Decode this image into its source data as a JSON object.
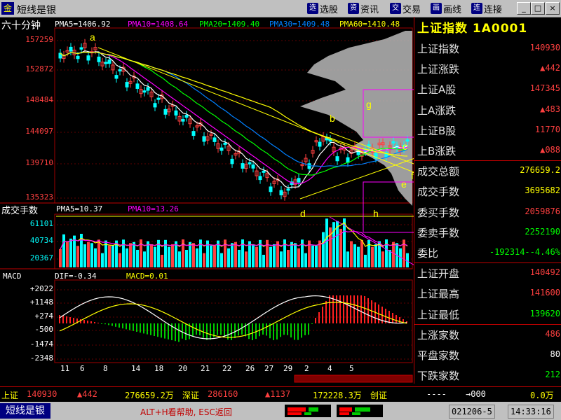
{
  "window": {
    "app_name": "短线是银",
    "app_icon": "金"
  },
  "toolbar": [
    {
      "label": "选股",
      "icon": "选"
    },
    {
      "label": "资讯",
      "icon": "资"
    },
    {
      "label": "交易",
      "icon": "交"
    },
    {
      "label": "画线",
      "icon": "画"
    },
    {
      "label": "连接",
      "icon": "连"
    }
  ],
  "window_buttons": [
    "_",
    "□",
    "×"
  ],
  "price_chart": {
    "period": "六十分钟",
    "ma": [
      {
        "label": "PMA5=1406.92",
        "color": "#ffffff"
      },
      {
        "label": "PMA10=1408.64",
        "color": "#ff00ff"
      },
      {
        "label": "PMA20=1409.40",
        "color": "#00ff00"
      },
      {
        "label": "PMA30=1409.48",
        "color": "#0080ff"
      },
      {
        "label": "PMA60=1410.48",
        "color": "#ffff00"
      }
    ],
    "y_ticks": [
      "157259",
      "152872",
      "148484",
      "144097",
      "139710",
      "135323"
    ],
    "annotations": [
      "a",
      "b",
      "c",
      "d",
      "e",
      "f",
      "g"
    ]
  },
  "volume_chart": {
    "title": "成交手数",
    "ma": [
      {
        "label": "PMA5=10.37",
        "color": "#ffffff"
      },
      {
        "label": "PMA10=13.26",
        "color": "#ff00ff"
      }
    ],
    "y_ticks": [
      "61101",
      "40734",
      "20367"
    ],
    "annotations": [
      "h"
    ]
  },
  "macd_chart": {
    "title": "MACD",
    "dif_label": "DIF=-0.34",
    "macd_label": "MACD=0.01",
    "y_ticks": [
      "+2022",
      "+1148",
      "+274",
      "-500",
      "-1474",
      "-2348"
    ]
  },
  "x_ticks": [
    "11",
    "6",
    "8",
    "14",
    "18",
    "20",
    "21",
    "22",
    "26",
    "27",
    "29",
    "2",
    "4",
    "5"
  ],
  "panel": {
    "title": "上证指数 1A0001",
    "rows": [
      {
        "key": "上证指数",
        "value": "140930",
        "color": "#ff4040"
      },
      {
        "key": "上证涨跌",
        "value": "▲442",
        "color": "#ff4040"
      },
      {
        "key": "上证A股",
        "value": "147345",
        "color": "#ff4040"
      },
      {
        "key": "上A涨跌",
        "value": "▲483",
        "color": "#ff4040"
      },
      {
        "key": "上证B股",
        "value": "11770",
        "color": "#ff4040"
      },
      {
        "key": "上B涨跌",
        "value": "▲088",
        "color": "#ff4040"
      },
      {
        "key": "成交总额",
        "value": "276659.2",
        "color": "#ffff00"
      },
      {
        "key": "成交手数",
        "value": "3695682",
        "color": "#ffff00"
      },
      {
        "key": "委买手数",
        "value": "2059876",
        "color": "#ff4040"
      },
      {
        "key": "委卖手数",
        "value": "2252190",
        "color": "#00ff00"
      },
      {
        "key": "委比",
        "value": "-192314--4.46%",
        "color": "#00ff00"
      },
      {
        "key": "上证开盘",
        "value": "140492",
        "color": "#ff4040"
      },
      {
        "key": "上证最高",
        "value": "141600",
        "color": "#ff4040"
      },
      {
        "key": "上证最低",
        "value": "139620",
        "color": "#00ff00"
      },
      {
        "key": "上涨家数",
        "value": "486",
        "color": "#ff4040"
      },
      {
        "key": "平盘家数",
        "value": "80",
        "color": "#ffffff"
      },
      {
        "key": "下跌家数",
        "value": "212",
        "color": "#00ff00"
      }
    ]
  },
  "ticker": {
    "sh_label": "上证",
    "sh_index": "140930",
    "sh_change": "▲442",
    "sh_amount": "276659.2万",
    "sz_label": "深证",
    "sz_index": "286160",
    "sz_change": "▲1137",
    "sz_amount": "172228.3万",
    "cz_label": "创证",
    "cz_index": "----",
    "cz_arrow": "→000",
    "cz_amount": "0.0万"
  },
  "statusbar": {
    "app_name": "短线是银",
    "help": "ALT+H看帮助, ESC返回",
    "date": "021206-5",
    "time": "14:33:16"
  }
}
